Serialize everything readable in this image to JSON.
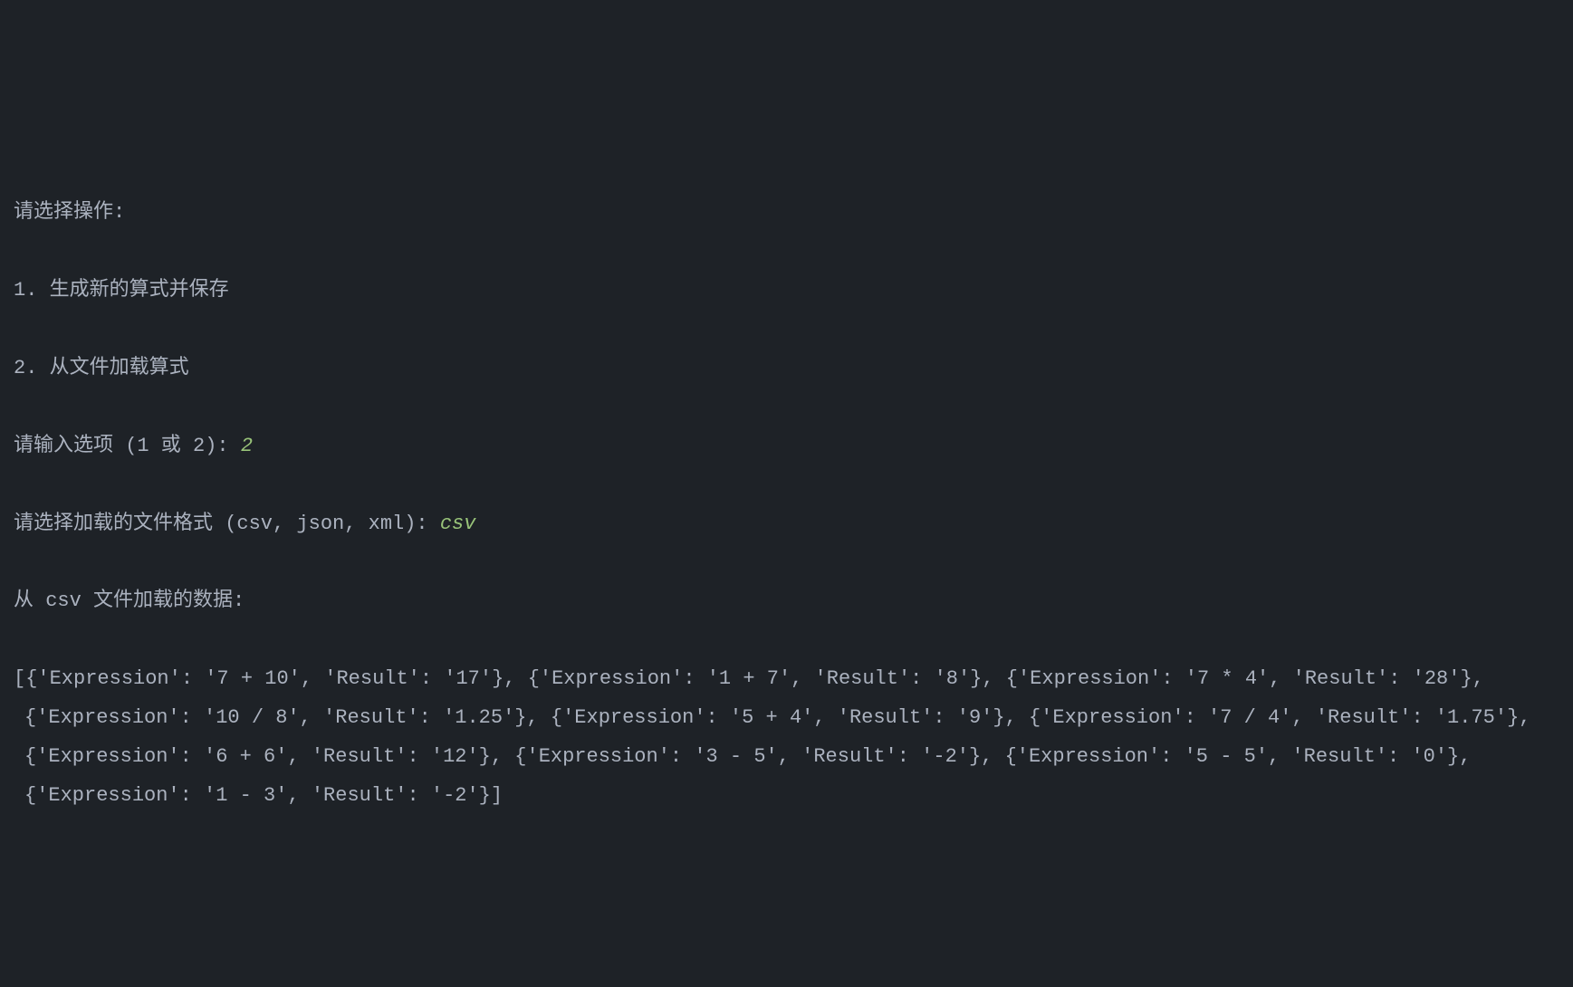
{
  "terminal": {
    "line0": "请选择操作:",
    "line1": "1. 生成新的算式并保存",
    "line2": "2. 从文件加载算式",
    "prompt1": "请输入选项 (1 或 2): ",
    "input1": "2",
    "prompt2": "请选择加载的文件格式 (csv, json, xml): ",
    "input2": "csv",
    "line5": "从 csv 文件加载的数据:",
    "output": "[{'Expression': '7 + 10', 'Result': '17'}, {'Expression': '1 + 7', 'Result': '8'}, {'Expression': '7 * 4', 'Result': '28'}, {'Expression': '10 / 8', 'Result': '1.25'}, {'Expression': '5 + 4', 'Result': '9'}, {'Expression': '7 / 4', 'Result': '1.75'}, {'Expression': '6 + 6', 'Result': '12'}, {'Expression': '3 - 5', 'Result': '-2'}, {'Expression': '5 - 5', 'Result': '0'}, {'Expression': '1 - 3', 'Result': '-2'}]"
  },
  "loaded_data": [
    {
      "Expression": "7 + 10",
      "Result": "17"
    },
    {
      "Expression": "1 + 7",
      "Result": "8"
    },
    {
      "Expression": "7 * 4",
      "Result": "28"
    },
    {
      "Expression": "10 / 8",
      "Result": "1.25"
    },
    {
      "Expression": "5 + 4",
      "Result": "9"
    },
    {
      "Expression": "7 / 4",
      "Result": "1.75"
    },
    {
      "Expression": "6 + 6",
      "Result": "12"
    },
    {
      "Expression": "3 - 5",
      "Result": "-2"
    },
    {
      "Expression": "5 - 5",
      "Result": "0"
    },
    {
      "Expression": "1 - 3",
      "Result": "-2"
    }
  ]
}
